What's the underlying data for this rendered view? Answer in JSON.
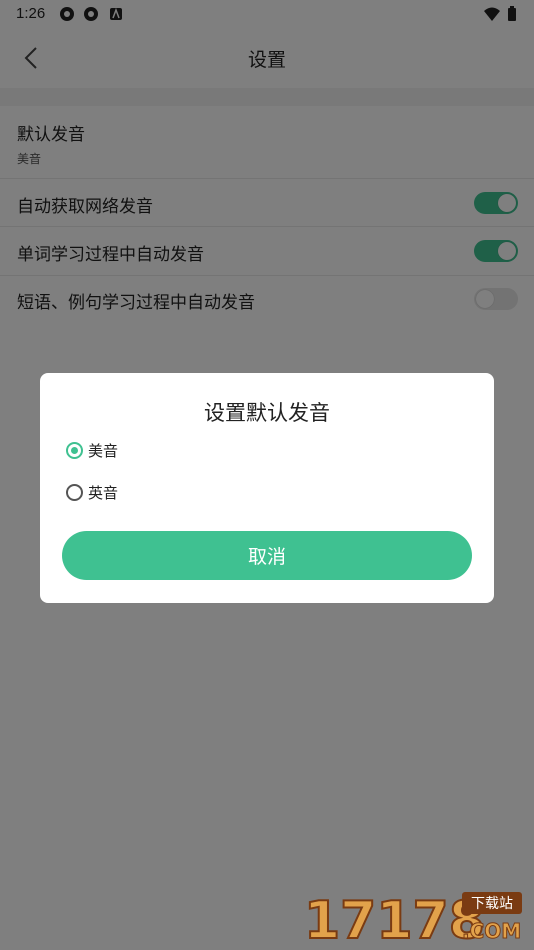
{
  "status_bar": {
    "time": "1:26",
    "icons": [
      "sync-icon",
      "sync-icon",
      "text-icon",
      "wifi-icon",
      "battery-icon"
    ]
  },
  "header": {
    "title": "设置",
    "back_icon": "chevron-left-icon"
  },
  "settings": {
    "default_pronunciation": {
      "label": "默认发音",
      "value": "美音"
    },
    "rows": [
      {
        "label": "自动获取网络发音",
        "toggle": true
      },
      {
        "label": "单词学习过程中自动发音",
        "toggle": true
      },
      {
        "label": "短语、例句学习过程中自动发音",
        "toggle": false
      }
    ]
  },
  "dialog": {
    "title": "设置默认发音",
    "options": [
      {
        "label": "美音",
        "selected": true
      },
      {
        "label": "英音",
        "selected": false
      }
    ],
    "cancel_label": "取消"
  },
  "watermark": {
    "text": "17178",
    "badge": "下载站",
    "suffix": ".COM"
  },
  "colors": {
    "accent": "#3fc191",
    "overlay": "rgba(0,0,0,0.5)"
  }
}
